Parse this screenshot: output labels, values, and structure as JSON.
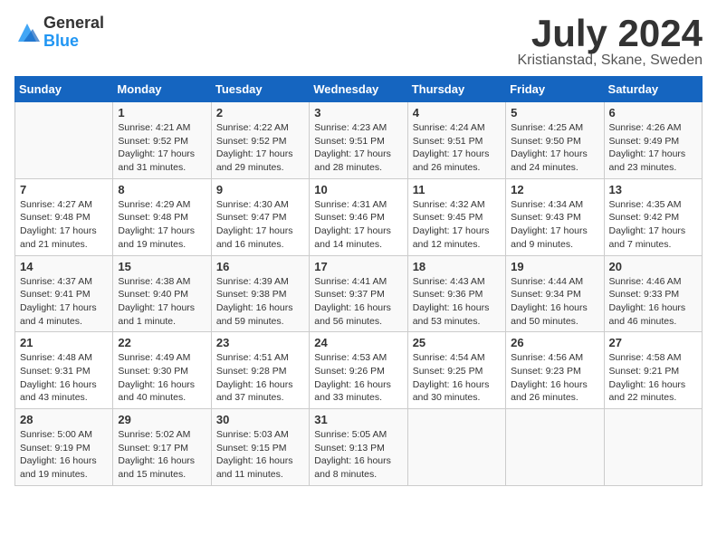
{
  "logo": {
    "general": "General",
    "blue": "Blue"
  },
  "title": {
    "month_year": "July 2024",
    "location": "Kristianstad, Skane, Sweden"
  },
  "calendar": {
    "headers": [
      "Sunday",
      "Monday",
      "Tuesday",
      "Wednesday",
      "Thursday",
      "Friday",
      "Saturday"
    ],
    "weeks": [
      [
        {
          "day": "",
          "info": ""
        },
        {
          "day": "1",
          "info": "Sunrise: 4:21 AM\nSunset: 9:52 PM\nDaylight: 17 hours\nand 31 minutes."
        },
        {
          "day": "2",
          "info": "Sunrise: 4:22 AM\nSunset: 9:52 PM\nDaylight: 17 hours\nand 29 minutes."
        },
        {
          "day": "3",
          "info": "Sunrise: 4:23 AM\nSunset: 9:51 PM\nDaylight: 17 hours\nand 28 minutes."
        },
        {
          "day": "4",
          "info": "Sunrise: 4:24 AM\nSunset: 9:51 PM\nDaylight: 17 hours\nand 26 minutes."
        },
        {
          "day": "5",
          "info": "Sunrise: 4:25 AM\nSunset: 9:50 PM\nDaylight: 17 hours\nand 24 minutes."
        },
        {
          "day": "6",
          "info": "Sunrise: 4:26 AM\nSunset: 9:49 PM\nDaylight: 17 hours\nand 23 minutes."
        }
      ],
      [
        {
          "day": "7",
          "info": "Sunrise: 4:27 AM\nSunset: 9:48 PM\nDaylight: 17 hours\nand 21 minutes."
        },
        {
          "day": "8",
          "info": "Sunrise: 4:29 AM\nSunset: 9:48 PM\nDaylight: 17 hours\nand 19 minutes."
        },
        {
          "day": "9",
          "info": "Sunrise: 4:30 AM\nSunset: 9:47 PM\nDaylight: 17 hours\nand 16 minutes."
        },
        {
          "day": "10",
          "info": "Sunrise: 4:31 AM\nSunset: 9:46 PM\nDaylight: 17 hours\nand 14 minutes."
        },
        {
          "day": "11",
          "info": "Sunrise: 4:32 AM\nSunset: 9:45 PM\nDaylight: 17 hours\nand 12 minutes."
        },
        {
          "day": "12",
          "info": "Sunrise: 4:34 AM\nSunset: 9:43 PM\nDaylight: 17 hours\nand 9 minutes."
        },
        {
          "day": "13",
          "info": "Sunrise: 4:35 AM\nSunset: 9:42 PM\nDaylight: 17 hours\nand 7 minutes."
        }
      ],
      [
        {
          "day": "14",
          "info": "Sunrise: 4:37 AM\nSunset: 9:41 PM\nDaylight: 17 hours\nand 4 minutes."
        },
        {
          "day": "15",
          "info": "Sunrise: 4:38 AM\nSunset: 9:40 PM\nDaylight: 17 hours\nand 1 minute."
        },
        {
          "day": "16",
          "info": "Sunrise: 4:39 AM\nSunset: 9:38 PM\nDaylight: 16 hours\nand 59 minutes."
        },
        {
          "day": "17",
          "info": "Sunrise: 4:41 AM\nSunset: 9:37 PM\nDaylight: 16 hours\nand 56 minutes."
        },
        {
          "day": "18",
          "info": "Sunrise: 4:43 AM\nSunset: 9:36 PM\nDaylight: 16 hours\nand 53 minutes."
        },
        {
          "day": "19",
          "info": "Sunrise: 4:44 AM\nSunset: 9:34 PM\nDaylight: 16 hours\nand 50 minutes."
        },
        {
          "day": "20",
          "info": "Sunrise: 4:46 AM\nSunset: 9:33 PM\nDaylight: 16 hours\nand 46 minutes."
        }
      ],
      [
        {
          "day": "21",
          "info": "Sunrise: 4:48 AM\nSunset: 9:31 PM\nDaylight: 16 hours\nand 43 minutes."
        },
        {
          "day": "22",
          "info": "Sunrise: 4:49 AM\nSunset: 9:30 PM\nDaylight: 16 hours\nand 40 minutes."
        },
        {
          "day": "23",
          "info": "Sunrise: 4:51 AM\nSunset: 9:28 PM\nDaylight: 16 hours\nand 37 minutes."
        },
        {
          "day": "24",
          "info": "Sunrise: 4:53 AM\nSunset: 9:26 PM\nDaylight: 16 hours\nand 33 minutes."
        },
        {
          "day": "25",
          "info": "Sunrise: 4:54 AM\nSunset: 9:25 PM\nDaylight: 16 hours\nand 30 minutes."
        },
        {
          "day": "26",
          "info": "Sunrise: 4:56 AM\nSunset: 9:23 PM\nDaylight: 16 hours\nand 26 minutes."
        },
        {
          "day": "27",
          "info": "Sunrise: 4:58 AM\nSunset: 9:21 PM\nDaylight: 16 hours\nand 22 minutes."
        }
      ],
      [
        {
          "day": "28",
          "info": "Sunrise: 5:00 AM\nSunset: 9:19 PM\nDaylight: 16 hours\nand 19 minutes."
        },
        {
          "day": "29",
          "info": "Sunrise: 5:02 AM\nSunset: 9:17 PM\nDaylight: 16 hours\nand 15 minutes."
        },
        {
          "day": "30",
          "info": "Sunrise: 5:03 AM\nSunset: 9:15 PM\nDaylight: 16 hours\nand 11 minutes."
        },
        {
          "day": "31",
          "info": "Sunrise: 5:05 AM\nSunset: 9:13 PM\nDaylight: 16 hours\nand 8 minutes."
        },
        {
          "day": "",
          "info": ""
        },
        {
          "day": "",
          "info": ""
        },
        {
          "day": "",
          "info": ""
        }
      ]
    ]
  }
}
